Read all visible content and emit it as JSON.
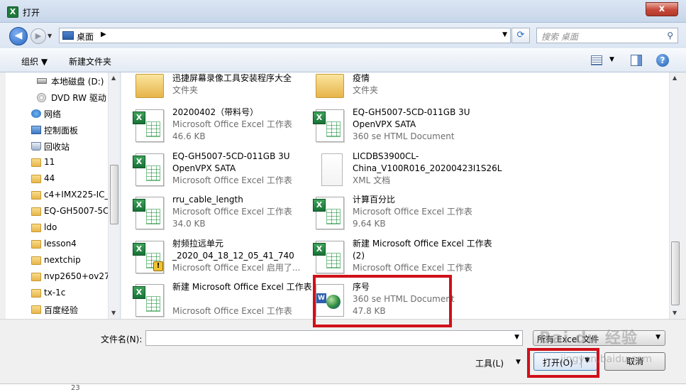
{
  "window": {
    "title": "打开",
    "app_icon": "X",
    "close": "x"
  },
  "address": {
    "location": "桌面",
    "search_placeholder": "搜索 桌面"
  },
  "toolbar": {
    "organize": "组织",
    "new_folder": "新建文件夹",
    "help": "?"
  },
  "sidebar": {
    "items": [
      {
        "label": "本地磁盘 (D:)",
        "icon": "drive-icon"
      },
      {
        "label": "DVD RW 驱动",
        "icon": "dvd-icon"
      },
      {
        "label": "网络",
        "icon": "network-icon"
      },
      {
        "label": "控制面板",
        "icon": "control-panel-icon"
      },
      {
        "label": "回收站",
        "icon": "recycle-bin-icon"
      },
      {
        "label": "11",
        "icon": "folder-icon"
      },
      {
        "label": "44",
        "icon": "folder-icon"
      },
      {
        "label": "c4+IMX225-IC_",
        "icon": "folder-icon"
      },
      {
        "label": "EQ-GH5007-5C",
        "icon": "folder-icon"
      },
      {
        "label": "ldo",
        "icon": "folder-icon"
      },
      {
        "label": "lesson4",
        "icon": "folder-icon"
      },
      {
        "label": "nextchip",
        "icon": "folder-icon"
      },
      {
        "label": "nvp2650+ov271",
        "icon": "folder-icon"
      },
      {
        "label": "tx-1c",
        "icon": "folder-icon"
      },
      {
        "label": "百度经验",
        "icon": "folder-icon"
      }
    ]
  },
  "files": [
    {
      "name": "迅捷屏幕录像工具安装程序大全",
      "type": "文件夹",
      "size": "",
      "icon": "folder-icon"
    },
    {
      "name": "疫情",
      "type": "文件夹",
      "size": "",
      "icon": "folder-icon"
    },
    {
      "name": "20200402（带料号）",
      "type": "Microsoft Office Excel 工作表",
      "size": "46.6 KB",
      "icon": "excel-file-icon"
    },
    {
      "name": "EQ-GH5007-5CD-011GB 3U OpenVPX SATA",
      "type": "360 se HTML Document",
      "size": "",
      "icon": "html-file-icon"
    },
    {
      "name": "EQ-GH5007-5CD-011GB 3U OpenVPX SATA",
      "type": "Microsoft Office Excel 工作表",
      "size": "",
      "icon": "excel-file-icon"
    },
    {
      "name": "LICDBS3900CL-China_V100R016_20200423I1S26L",
      "type": "XML 文档",
      "size": "",
      "icon": "xml-file-icon"
    },
    {
      "name": "rru_cable_length",
      "type": "Microsoft Office Excel 工作表",
      "size": "34.0 KB",
      "icon": "excel-file-icon"
    },
    {
      "name": "计算百分比",
      "type": "Microsoft Office Excel 工作表",
      "size": "9.64 KB",
      "icon": "excel-file-icon"
    },
    {
      "name": "射频拉远单元_2020_04_18_12_05_41_740",
      "type": "Microsoft Office Excel 启用了...",
      "size": "",
      "icon": "excel-macro-file-icon"
    },
    {
      "name": "新建 Microsoft Office Excel 工作表 (2)",
      "type": "Microsoft Office Excel 工作表",
      "size": "",
      "icon": "excel-file-icon"
    },
    {
      "name": "新建 Microsoft Office Excel 工作表",
      "type": "Microsoft Office Excel 工作表",
      "size": "",
      "icon": "excel-file-icon"
    },
    {
      "name": "序号",
      "type": "360 se HTML Document",
      "size": "47.8 KB",
      "icon": "html-file-icon"
    }
  ],
  "bottom": {
    "filename_label": "文件名(N):",
    "filename_value": "",
    "filetype_value": "所有 Excel 文件",
    "tools": "工具(L)",
    "open": "打开(O)",
    "cancel": "取消"
  },
  "watermark": {
    "brand": "Bai du 经验",
    "url": "jingyan.baidu.com"
  },
  "background": {
    "row_number": "23"
  },
  "colors": {
    "highlight": "#d0101a",
    "accent": "#3c7fb1"
  }
}
